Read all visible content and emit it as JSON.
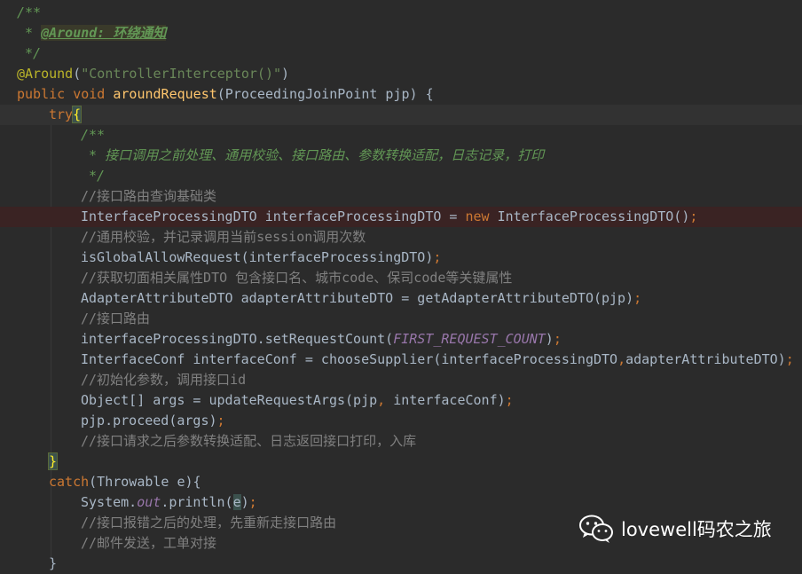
{
  "code": {
    "l1": "/**",
    "l2_prefix": " * ",
    "l2_tag": "@Around: 环绕通知",
    "l3": " */",
    "l4_ann": "@Around",
    "l4_open": "(",
    "l4_str": "\"ControllerInterceptor()\"",
    "l4_close": ")",
    "l5_kw": "public void ",
    "l5_fn": "aroundRequest",
    "l5_rest": "(ProceedingJoinPoint pjp) {",
    "l6_kw": "try",
    "l6_brace": "{",
    "l7": "/**",
    "l8": " * 接口调用之前处理、通用校验、接口路由、参数转换适配，日志记录，打印",
    "l9": " */",
    "l10": "//接口路由查询基础类",
    "l11_a": "InterfaceProcessingDTO interfaceProcessingDTO = ",
    "l11_kw": "new",
    "l11_b": " InterfaceProcessingDTO()",
    "l11_semi": ";",
    "l12": "//通用校验，并记录调用当前session调用次数",
    "l13_a": "isGlobalAllowRequest(interfaceProcessingDTO)",
    "l13_semi": ";",
    "l14": "//获取切面相关属性DTO 包含接口名、城市code、保司code等关键属性",
    "l15_a": "AdapterAttributeDTO adapterAttributeDTO = getAdapterAttributeDTO(pjp)",
    "l15_semi": ";",
    "l16": "//接口路由",
    "l17_a": "interfaceProcessingDTO.setRequestCount(",
    "l17_const": "FIRST_REQUEST_COUNT",
    "l17_b": ")",
    "l17_semi": ";",
    "l18_a": "InterfaceConf interfaceConf = chooseSupplier(interfaceProcessingDTO",
    "l18_comma": ",",
    "l18_b": "adapterAttributeDTO)",
    "l18_semi": ";",
    "l19": "//初始化参数，调用接口id",
    "l20_a": "Object[] args = updateRequestArgs(pjp",
    "l20_comma": ",",
    "l20_b": " interfaceConf)",
    "l20_semi": ";",
    "l21_a": "pjp.proceed(args)",
    "l21_semi": ";",
    "l22": "//接口请求之后参数转换适配、日志返回接口打印，入库",
    "l23_brace": "}",
    "l24_kw": "catch",
    "l24_rest": "(Throwable e){",
    "l25_a": "System.",
    "l25_out": "out",
    "l25_b": ".println(",
    "l25_e": "e",
    "l25_c": ")",
    "l25_semi": ";",
    "l26": "//接口报错之后的处理，先重新走接口路由",
    "l27": "//邮件发送，工单对接",
    "l28": "}"
  },
  "watermark": {
    "text": "lovewell码农之旅",
    "icon": "wechat-icon"
  },
  "colors": {
    "background": "#2b2b2b",
    "keyword": "#cc7832",
    "comment": "#629755",
    "string": "#6a8759",
    "annotation": "#bbb529",
    "method": "#ffc66d",
    "text": "#a9b7c6",
    "constant": "#9876aa",
    "line_comment": "#808080"
  }
}
